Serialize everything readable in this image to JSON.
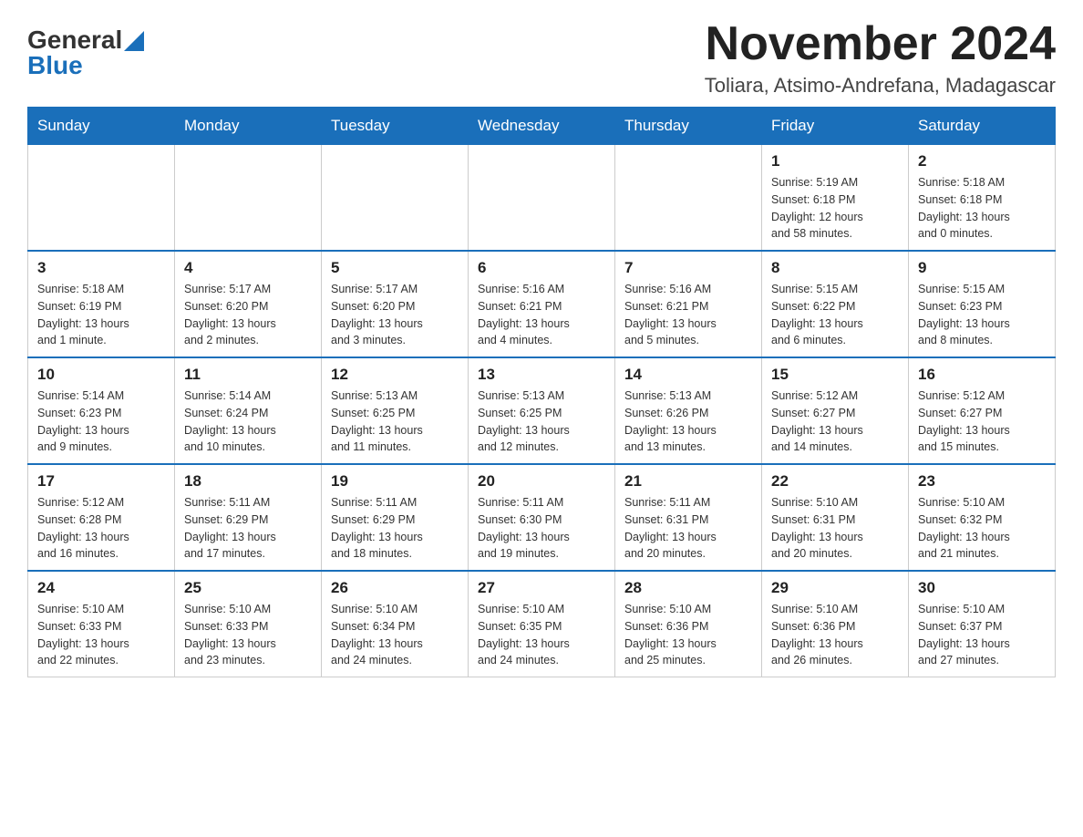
{
  "header": {
    "logo_general": "General",
    "logo_blue": "Blue",
    "month_title": "November 2024",
    "location": "Toliara, Atsimo-Andrefana, Madagascar"
  },
  "weekdays": [
    "Sunday",
    "Monday",
    "Tuesday",
    "Wednesday",
    "Thursday",
    "Friday",
    "Saturday"
  ],
  "weeks": [
    [
      {
        "day": "",
        "info": ""
      },
      {
        "day": "",
        "info": ""
      },
      {
        "day": "",
        "info": ""
      },
      {
        "day": "",
        "info": ""
      },
      {
        "day": "",
        "info": ""
      },
      {
        "day": "1",
        "info": "Sunrise: 5:19 AM\nSunset: 6:18 PM\nDaylight: 12 hours\nand 58 minutes."
      },
      {
        "day": "2",
        "info": "Sunrise: 5:18 AM\nSunset: 6:18 PM\nDaylight: 13 hours\nand 0 minutes."
      }
    ],
    [
      {
        "day": "3",
        "info": "Sunrise: 5:18 AM\nSunset: 6:19 PM\nDaylight: 13 hours\nand 1 minute."
      },
      {
        "day": "4",
        "info": "Sunrise: 5:17 AM\nSunset: 6:20 PM\nDaylight: 13 hours\nand 2 minutes."
      },
      {
        "day": "5",
        "info": "Sunrise: 5:17 AM\nSunset: 6:20 PM\nDaylight: 13 hours\nand 3 minutes."
      },
      {
        "day": "6",
        "info": "Sunrise: 5:16 AM\nSunset: 6:21 PM\nDaylight: 13 hours\nand 4 minutes."
      },
      {
        "day": "7",
        "info": "Sunrise: 5:16 AM\nSunset: 6:21 PM\nDaylight: 13 hours\nand 5 minutes."
      },
      {
        "day": "8",
        "info": "Sunrise: 5:15 AM\nSunset: 6:22 PM\nDaylight: 13 hours\nand 6 minutes."
      },
      {
        "day": "9",
        "info": "Sunrise: 5:15 AM\nSunset: 6:23 PM\nDaylight: 13 hours\nand 8 minutes."
      }
    ],
    [
      {
        "day": "10",
        "info": "Sunrise: 5:14 AM\nSunset: 6:23 PM\nDaylight: 13 hours\nand 9 minutes."
      },
      {
        "day": "11",
        "info": "Sunrise: 5:14 AM\nSunset: 6:24 PM\nDaylight: 13 hours\nand 10 minutes."
      },
      {
        "day": "12",
        "info": "Sunrise: 5:13 AM\nSunset: 6:25 PM\nDaylight: 13 hours\nand 11 minutes."
      },
      {
        "day": "13",
        "info": "Sunrise: 5:13 AM\nSunset: 6:25 PM\nDaylight: 13 hours\nand 12 minutes."
      },
      {
        "day": "14",
        "info": "Sunrise: 5:13 AM\nSunset: 6:26 PM\nDaylight: 13 hours\nand 13 minutes."
      },
      {
        "day": "15",
        "info": "Sunrise: 5:12 AM\nSunset: 6:27 PM\nDaylight: 13 hours\nand 14 minutes."
      },
      {
        "day": "16",
        "info": "Sunrise: 5:12 AM\nSunset: 6:27 PM\nDaylight: 13 hours\nand 15 minutes."
      }
    ],
    [
      {
        "day": "17",
        "info": "Sunrise: 5:12 AM\nSunset: 6:28 PM\nDaylight: 13 hours\nand 16 minutes."
      },
      {
        "day": "18",
        "info": "Sunrise: 5:11 AM\nSunset: 6:29 PM\nDaylight: 13 hours\nand 17 minutes."
      },
      {
        "day": "19",
        "info": "Sunrise: 5:11 AM\nSunset: 6:29 PM\nDaylight: 13 hours\nand 18 minutes."
      },
      {
        "day": "20",
        "info": "Sunrise: 5:11 AM\nSunset: 6:30 PM\nDaylight: 13 hours\nand 19 minutes."
      },
      {
        "day": "21",
        "info": "Sunrise: 5:11 AM\nSunset: 6:31 PM\nDaylight: 13 hours\nand 20 minutes."
      },
      {
        "day": "22",
        "info": "Sunrise: 5:10 AM\nSunset: 6:31 PM\nDaylight: 13 hours\nand 20 minutes."
      },
      {
        "day": "23",
        "info": "Sunrise: 5:10 AM\nSunset: 6:32 PM\nDaylight: 13 hours\nand 21 minutes."
      }
    ],
    [
      {
        "day": "24",
        "info": "Sunrise: 5:10 AM\nSunset: 6:33 PM\nDaylight: 13 hours\nand 22 minutes."
      },
      {
        "day": "25",
        "info": "Sunrise: 5:10 AM\nSunset: 6:33 PM\nDaylight: 13 hours\nand 23 minutes."
      },
      {
        "day": "26",
        "info": "Sunrise: 5:10 AM\nSunset: 6:34 PM\nDaylight: 13 hours\nand 24 minutes."
      },
      {
        "day": "27",
        "info": "Sunrise: 5:10 AM\nSunset: 6:35 PM\nDaylight: 13 hours\nand 24 minutes."
      },
      {
        "day": "28",
        "info": "Sunrise: 5:10 AM\nSunset: 6:36 PM\nDaylight: 13 hours\nand 25 minutes."
      },
      {
        "day": "29",
        "info": "Sunrise: 5:10 AM\nSunset: 6:36 PM\nDaylight: 13 hours\nand 26 minutes."
      },
      {
        "day": "30",
        "info": "Sunrise: 5:10 AM\nSunset: 6:37 PM\nDaylight: 13 hours\nand 27 minutes."
      }
    ]
  ]
}
